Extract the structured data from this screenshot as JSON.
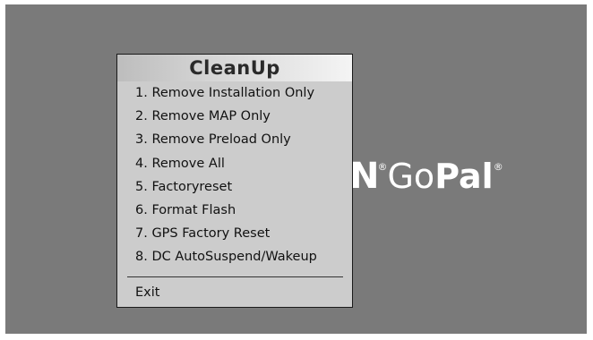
{
  "background": {
    "color": "#7a7a7a",
    "logo": {
      "partial": "N",
      "reg_mark": "®",
      "go": "Go",
      "pal": "Pal",
      "reg_mark_end": "®"
    }
  },
  "menu": {
    "title": "CleanUp",
    "items": [
      "1. Remove Installation Only",
      "2. Remove MAP Only",
      "3. Remove Preload Only",
      "4. Remove All",
      "5. Factoryreset",
      "6. Format Flash",
      "7. GPS Factory Reset",
      "8. DC AutoSuspend/Wakeup"
    ],
    "exit_label": "Exit"
  }
}
